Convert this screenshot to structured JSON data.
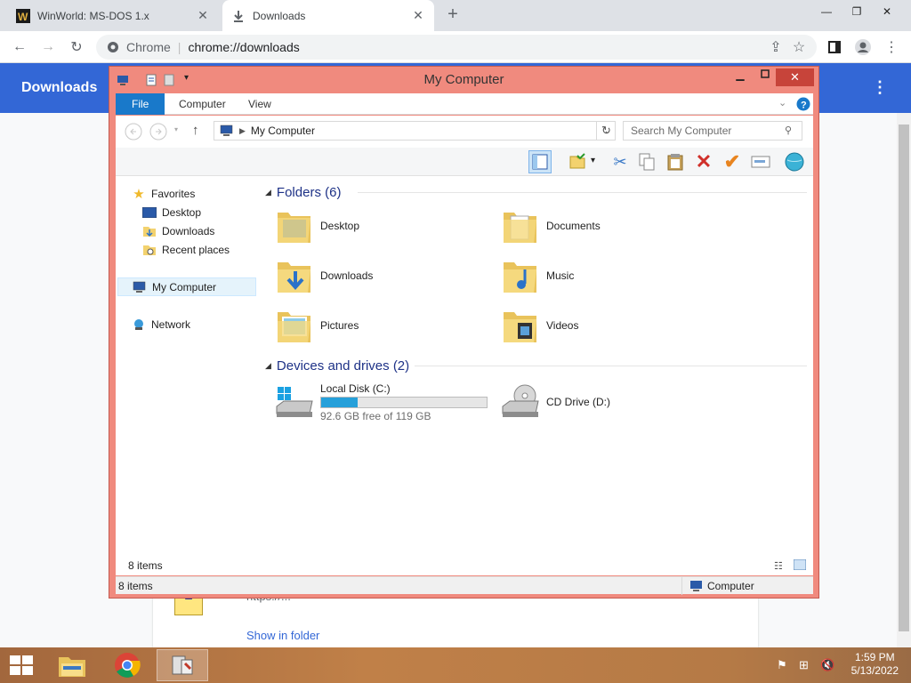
{
  "browser": {
    "tabs": [
      {
        "title": "WinWorld: MS-DOS 1.x",
        "favicon": "winworld-logo-icon",
        "active": false
      },
      {
        "title": "Downloads",
        "favicon": "download-icon",
        "active": true
      }
    ],
    "omnibox": {
      "site": "Chrome",
      "url": "chrome://downloads"
    }
  },
  "downloads_page": {
    "title": "Downloads",
    "item_url": "https://...",
    "show_in_folder": "Show in folder"
  },
  "explorer": {
    "title": "My Computer",
    "ribbon_tabs": [
      "File",
      "Computer",
      "View"
    ],
    "address": "My Computer",
    "search_placeholder": "Search My Computer",
    "nav": {
      "favorites_label": "Favorites",
      "favorites": [
        "Desktop",
        "Downloads",
        "Recent places"
      ],
      "computer_label": "My Computer",
      "network_label": "Network"
    },
    "folders_header": "Folders (6)",
    "folders": [
      {
        "name": "Desktop",
        "icon": "desktop-folder-icon"
      },
      {
        "name": "Documents",
        "icon": "documents-folder-icon"
      },
      {
        "name": "Downloads",
        "icon": "downloads-folder-icon"
      },
      {
        "name": "Music",
        "icon": "music-folder-icon"
      },
      {
        "name": "Pictures",
        "icon": "pictures-folder-icon"
      },
      {
        "name": "Videos",
        "icon": "videos-folder-icon"
      }
    ],
    "drives_header": "Devices and drives (2)",
    "drives": [
      {
        "name": "Local Disk (C:)",
        "free": "92.6 GB free of 119 GB",
        "used_fraction": 0.22,
        "icon": "hard-disk-icon"
      },
      {
        "name": "CD Drive (D:)",
        "icon": "cd-drive-icon"
      }
    ],
    "footer_count": "8 items",
    "status_count": "8 items",
    "status_location": "Computer"
  },
  "taskbar": {
    "time": "1:59 PM",
    "date": "5/13/2022"
  }
}
